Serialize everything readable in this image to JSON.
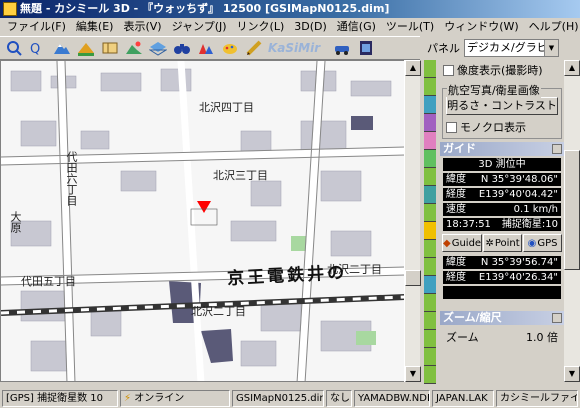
{
  "window": {
    "title": "無題 - カシミール 3D - 『ウォッちず』 12500 [GSIMapN0125.dim]"
  },
  "menu": [
    "ファイル(F)",
    "編集(E)",
    "表示(V)",
    "ジャンプ(J)",
    "リンク(L)",
    "3D(D)",
    "通信(G)",
    "ツール(T)",
    "ウィンドウ(W)",
    "ヘルプ(H)"
  ],
  "toolbar": {
    "logo": "KaSiMir"
  },
  "panel": {
    "label": "パネル",
    "select": "デジカメ/グラビィ",
    "photo_checkbox": "像度表示(撮影時)",
    "aerial_group": "航空写真/衛星画像",
    "brightness_button": "明るさ・コントラスト",
    "mono_checkbox": "モノクロ表示",
    "guide_title": "ガイド",
    "guide_status": "3D 測位中",
    "guide_lat_label": "緯度",
    "guide_lat": "N 35°39'48.06\"",
    "guide_lon_label": "経度",
    "guide_lon": "E139°40'04.42\"",
    "speed_label": "速度",
    "speed": "0.1 km/h",
    "time": "18:37:51",
    "satellites": "捕捉衛星:10",
    "tabs": [
      "Guide",
      "Point",
      "GPS"
    ],
    "point_lat_label": "緯度",
    "point_lat": "N 35°39'56.74\"",
    "point_lon_label": "経度",
    "point_lon": "E139°40'26.34\"",
    "zoom_title": "ズーム/縮尺",
    "zoom_label": "ズーム",
    "zoom_value": "1.0 倍"
  },
  "map": {
    "labels": [
      "北沢四丁目",
      "北沢三丁目",
      "北沢二丁目",
      "北沢二丁目",
      "代田六丁目",
      "代田五丁目",
      "京王電鉄井の",
      "北沢",
      "大原"
    ],
    "vertical_labels": [
      "大原"
    ]
  },
  "colors": {
    "title_start": "#0a246a",
    "marker": "#ff0000",
    "colorbar": [
      "#80c040",
      "#80c040",
      "#40a0c0",
      "#a060c0",
      "#e080c0",
      "#60c060",
      "#80c040",
      "#40a0a0",
      "#80c040",
      "#f0c000",
      "#80c040",
      "#80c040",
      "#40a0c0",
      "#80c040",
      "#80c040",
      "#80c040",
      "#80c040",
      "#80c040"
    ]
  },
  "status": {
    "gps": "[GPS] 捕捉衛星数 10",
    "online": "オンライン",
    "map_file": "GSIMapN0125.dim",
    "none": "なし",
    "db": "YAMADBW.NDB",
    "lak": "JAPAN.LAK",
    "kashmir_file": "カシミールファイル"
  }
}
